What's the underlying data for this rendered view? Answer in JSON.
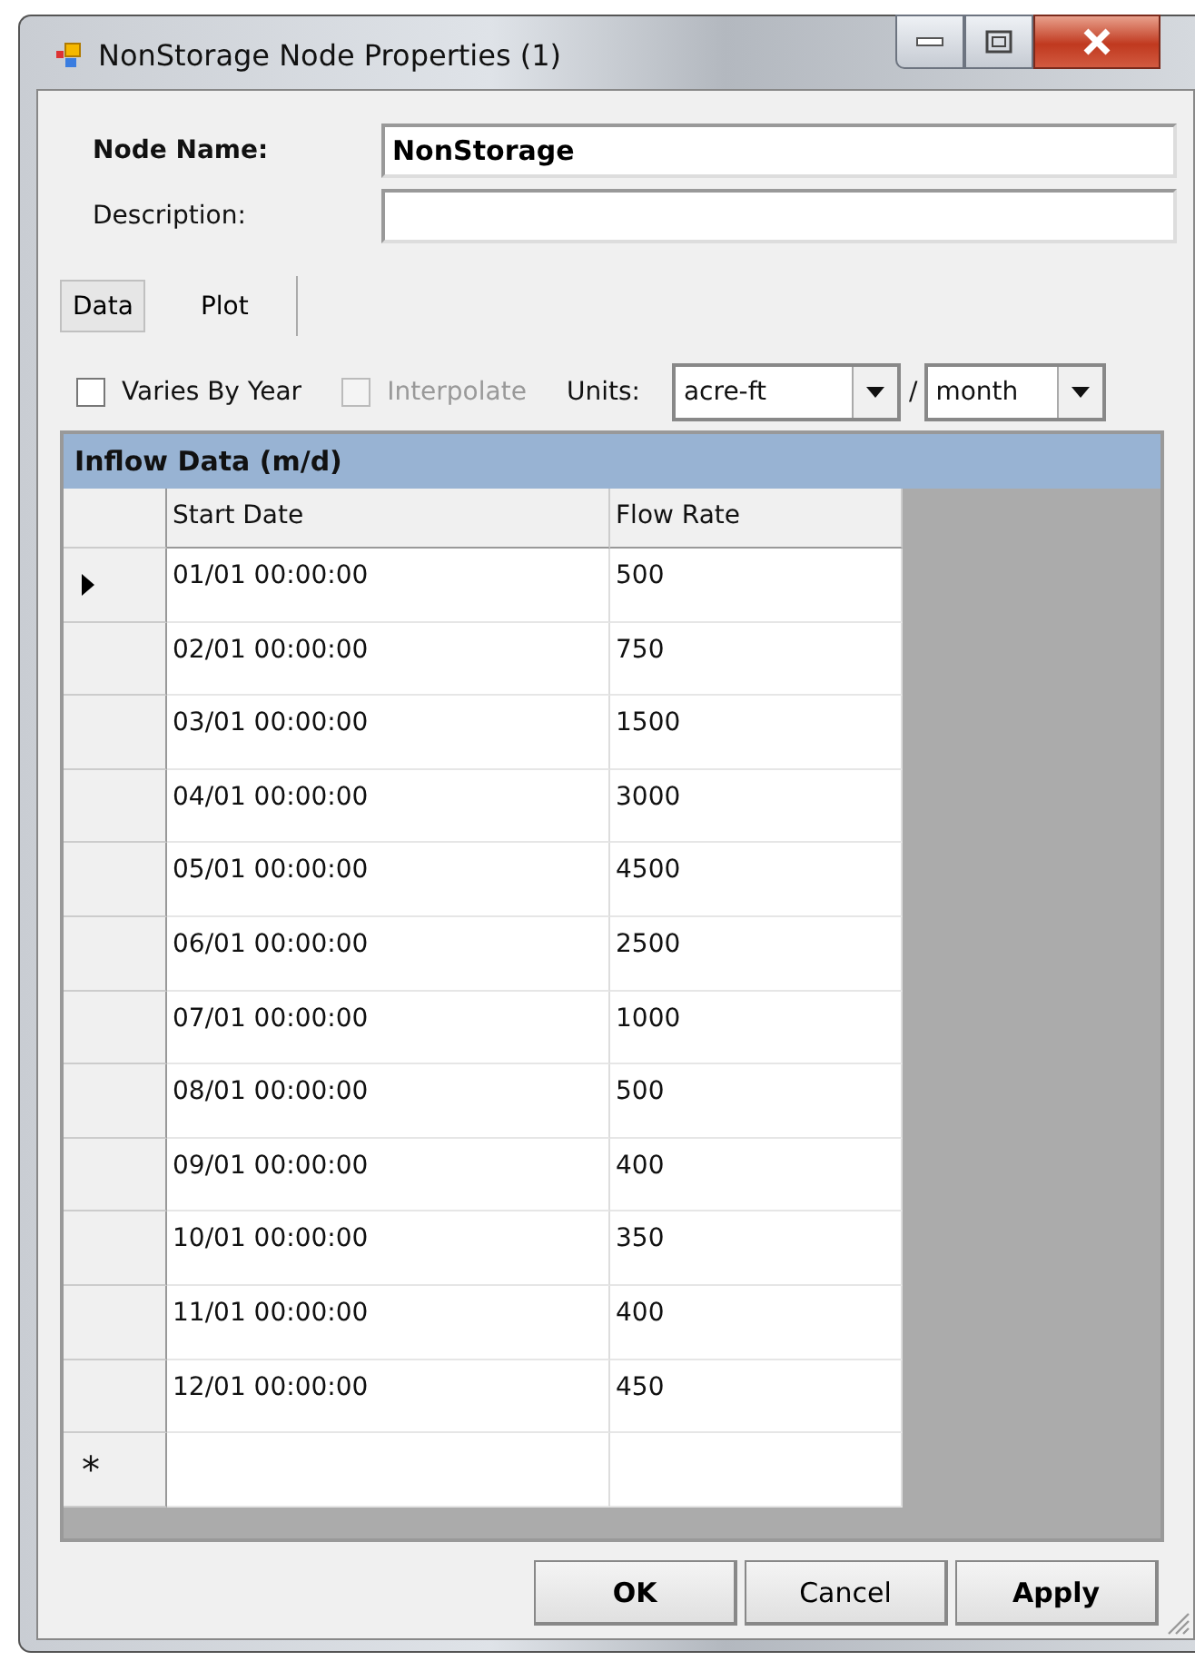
{
  "window": {
    "title": "NonStorage Node Properties (1)"
  },
  "node_name": {
    "label": "Node Name:",
    "value": "NonStorage"
  },
  "description": {
    "label": "Description:"
  },
  "tabs": [
    {
      "label": "Data",
      "selected": true
    },
    {
      "label": "Plot",
      "selected": false
    }
  ],
  "options": [
    {
      "label": "Varies By Year",
      "checked": false,
      "disabled": false
    },
    {
      "label": "Interpolate",
      "checked": false,
      "disabled": true
    }
  ],
  "units": {
    "label": "Units:",
    "volume": "acre-ft",
    "separator": "/",
    "time": "month"
  },
  "grid": {
    "title": "Inflow Data (m/d)",
    "columns": [
      "Start Date",
      "Flow Rate"
    ],
    "rows": [
      {
        "cells": [
          "01/01 00:00:00",
          "500"
        ],
        "current": true
      },
      {
        "cells": [
          "02/01 00:00:00",
          "750"
        ],
        "current": false
      },
      {
        "cells": [
          "03/01 00:00:00",
          "1500"
        ],
        "current": false
      },
      {
        "cells": [
          "04/01 00:00:00",
          "3000"
        ],
        "current": false
      },
      {
        "cells": [
          "05/01 00:00:00",
          "4500"
        ],
        "current": false
      },
      {
        "cells": [
          "06/01 00:00:00",
          "2500"
        ],
        "current": false
      },
      {
        "cells": [
          "07/01 00:00:00",
          "1000"
        ],
        "current": false
      },
      {
        "cells": [
          "08/01 00:00:00",
          "500"
        ],
        "current": false
      },
      {
        "cells": [
          "09/01 00:00:00",
          "400"
        ],
        "current": false
      },
      {
        "cells": [
          "10/01 00:00:00",
          "350"
        ],
        "current": false
      },
      {
        "cells": [
          "11/01 00:00:00",
          "400"
        ],
        "current": false
      },
      {
        "cells": [
          "12/01 00:00:00",
          "450"
        ],
        "current": false
      }
    ],
    "new_row_marker": "*"
  },
  "buttons": [
    {
      "label": "OK",
      "bold": true
    },
    {
      "label": "Cancel",
      "bold": false
    },
    {
      "label": "Apply",
      "bold": true
    }
  ]
}
